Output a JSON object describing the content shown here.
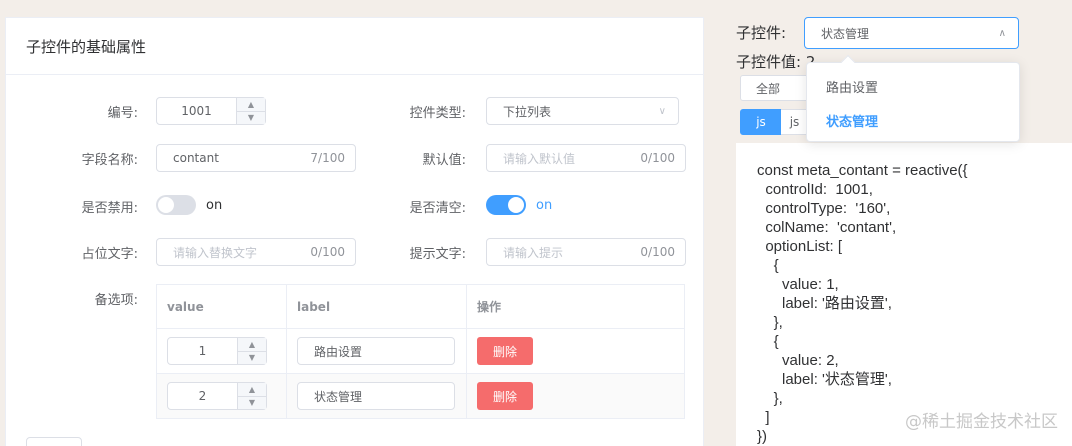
{
  "card": {
    "title": "子控件的基础属性"
  },
  "form": {
    "id": {
      "label": "编号:",
      "value": "1001"
    },
    "control_type": {
      "label": "控件类型:",
      "value": "下拉列表"
    },
    "field_name": {
      "label": "字段名称:",
      "value": "contant",
      "count": "7/100"
    },
    "default_value": {
      "label": "默认值:",
      "placeholder": "请输入默认值",
      "count": "0/100"
    },
    "disabled": {
      "label": "是否禁用:",
      "text": "on",
      "checked": false
    },
    "clearable": {
      "label": "是否清空:",
      "text": "on",
      "checked": true
    },
    "placeholder_text": {
      "label": "占位文字:",
      "placeholder": "请输入替换文字",
      "count": "0/100"
    },
    "hint_text": {
      "label": "提示文字:",
      "placeholder": "请输入提示",
      "count": "0/100"
    },
    "options_label": "备选项:"
  },
  "options_table": {
    "headers": [
      "value",
      "label",
      "操作"
    ],
    "rows": [
      {
        "value": "1",
        "label": "路由设置",
        "action": "删除"
      },
      {
        "value": "2",
        "label": "状态管理",
        "action": "删除"
      }
    ]
  },
  "right": {
    "child_label": "子控件:",
    "child_selected": "状态管理",
    "child_value_label": "子控件值: 2",
    "tabs_row1": [
      "全部"
    ],
    "tabs_row2": [
      "js",
      "js"
    ],
    "dropdown_options": [
      "路由设置",
      "状态管理"
    ],
    "code": "const meta_contant = reactive({\n  controlId:  1001,\n  controlType:  '160',\n  colName:  'contant',\n  optionList: [\n    {\n      value: 1,\n      label: '路由设置',\n    },\n    {\n      value: 2,\n      label: '状态管理',\n    },\n  ]\n})"
  },
  "watermark": "@稀土掘金技术社区",
  "colors": {
    "primary": "#409eff",
    "danger": "#f56c6c",
    "background": "#f3eee9"
  }
}
